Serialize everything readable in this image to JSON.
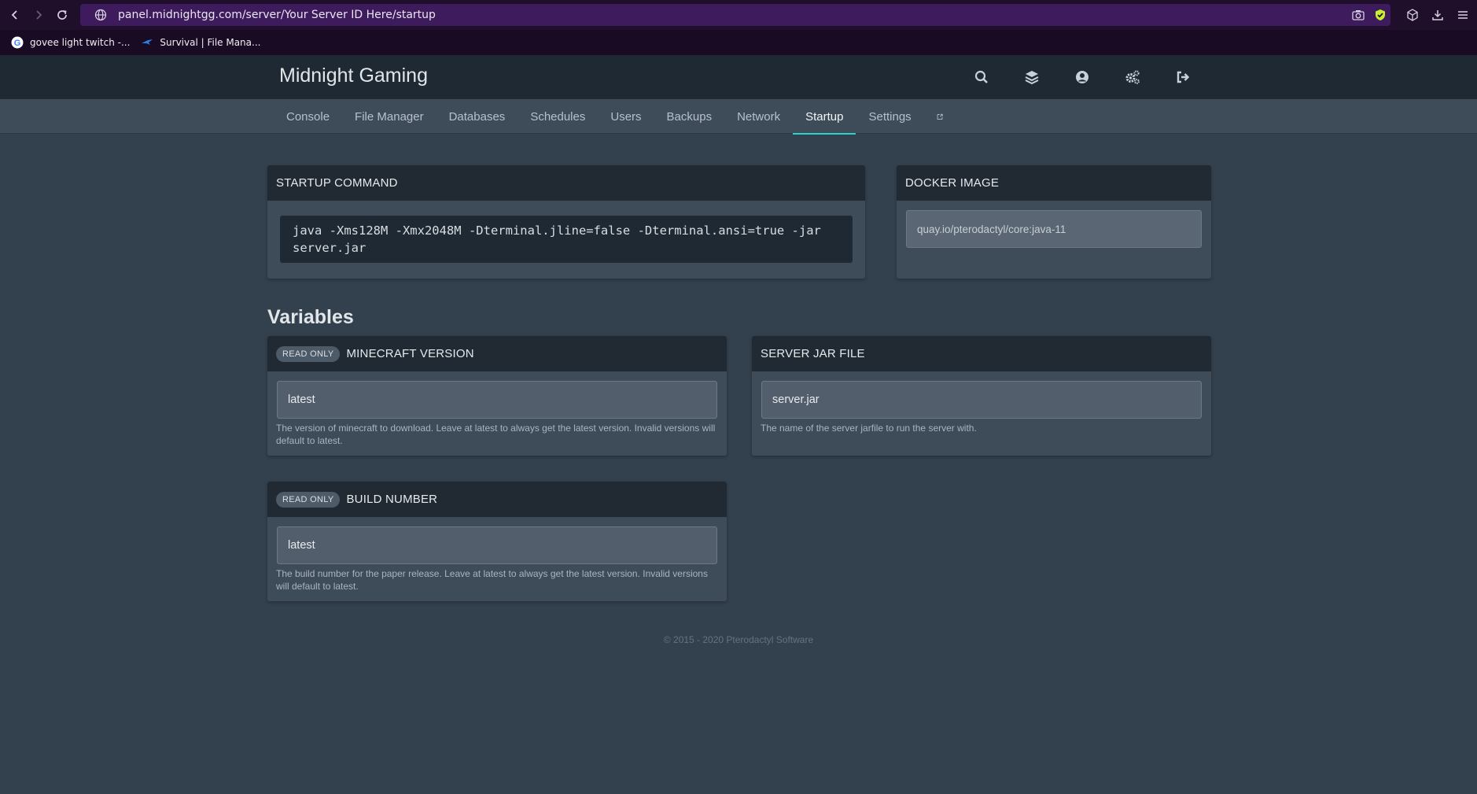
{
  "browser": {
    "url": "panel.midnightgg.com/server/Your Server ID Here/startup",
    "bookmarks": [
      {
        "label": "govee light twitch -..."
      },
      {
        "label": "Survival | File Mana..."
      }
    ]
  },
  "header": {
    "brand": "Midnight Gaming",
    "icons": [
      "search-icon",
      "layers-icon",
      "user-circle-icon",
      "cogs-icon",
      "sign-out-icon"
    ]
  },
  "tabs": [
    {
      "label": "Console"
    },
    {
      "label": "File Manager"
    },
    {
      "label": "Databases"
    },
    {
      "label": "Schedules"
    },
    {
      "label": "Users"
    },
    {
      "label": "Backups"
    },
    {
      "label": "Network"
    },
    {
      "label": "Startup",
      "active": true
    },
    {
      "label": "Settings"
    }
  ],
  "startup": {
    "title": "STARTUP COMMAND",
    "command": "java -Xms128M -Xmx2048M -Dterminal.jline=false -Dterminal.ansi=true -jar server.jar"
  },
  "docker": {
    "title": "DOCKER IMAGE",
    "image": "quay.io/pterodactyl/core:java-11"
  },
  "variables": {
    "title": "Variables",
    "items": [
      {
        "badge": "READ ONLY",
        "name": "MINECRAFT VERSION",
        "value": "latest",
        "description": "The version of minecraft to download. Leave at latest to always get the latest version. Invalid versions will default to latest."
      },
      {
        "badge": "",
        "name": "SERVER JAR FILE",
        "value": "server.jar",
        "description": "The name of the server jarfile to run the server with."
      },
      {
        "badge": "READ ONLY",
        "name": "BUILD NUMBER",
        "value": "latest",
        "description": "The build number for the paper release. Leave at latest to always get the latest version. Invalid versions will default to latest."
      }
    ]
  },
  "footer": "© 2015 - 2020 Pterodactyl Software",
  "colors": {
    "accent": "#2bd3c7",
    "page_bg": "#33404d",
    "header_bg": "#1f2933"
  }
}
